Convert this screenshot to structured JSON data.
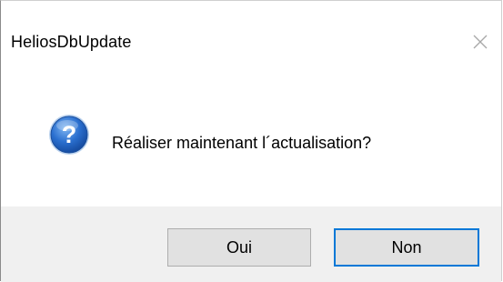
{
  "window": {
    "title": "HeliosDbUpdate",
    "close_icon": "close-icon"
  },
  "message": {
    "icon": "question-icon",
    "text": "Réaliser maintenant l´actualisation?"
  },
  "buttons": {
    "yes_label": "Oui",
    "no_label": "Non",
    "default": "no"
  },
  "colors": {
    "footer_bg": "#f0f0f0",
    "button_bg": "#e1e1e1",
    "focus_border": "#0078d7",
    "icon_blue": "#1f5fb8"
  }
}
